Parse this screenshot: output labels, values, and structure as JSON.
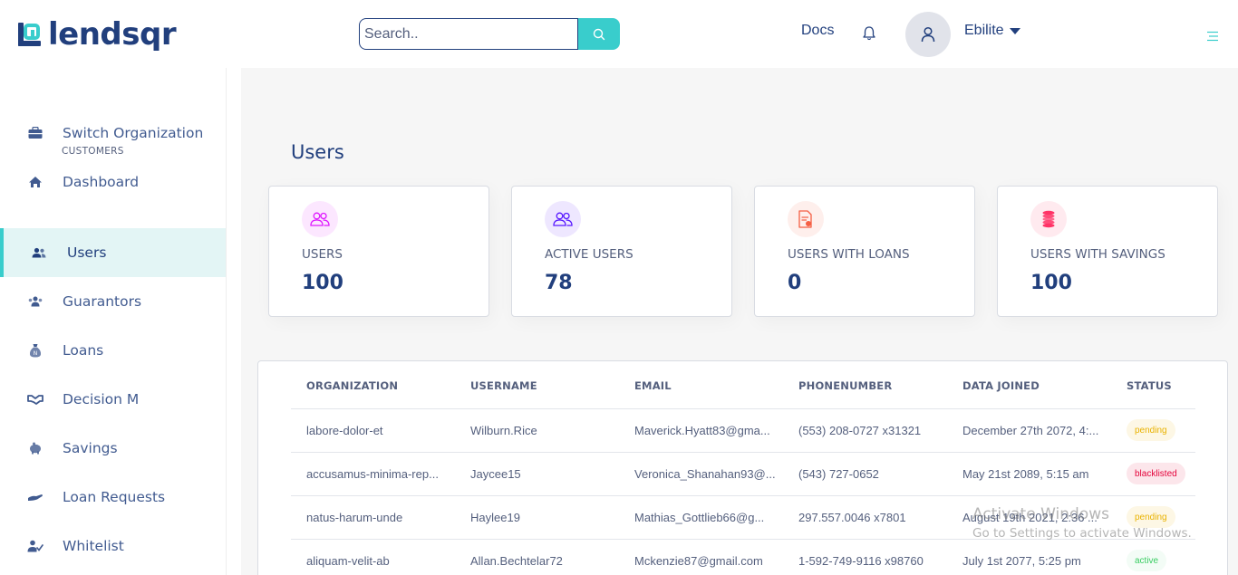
{
  "header": {
    "brand": "lendsqr",
    "search_placeholder": "Search..",
    "docs_label": "Docs",
    "user_name": "Ebilite",
    "accent_color": "#39CDCC",
    "brand_color": "#213F7D"
  },
  "sidebar": {
    "switch_org": "Switch Organization",
    "dashboard": "Dashboard",
    "section_customers": "CUSTOMERS",
    "items": [
      {
        "label": "Users",
        "icon": "users-icon",
        "active": true
      },
      {
        "label": "Guarantors",
        "icon": "guarantors-icon",
        "active": false
      },
      {
        "label": "Loans",
        "icon": "loan-bag-icon",
        "active": false
      },
      {
        "label": "Decision M",
        "icon": "handshake-icon",
        "active": false
      },
      {
        "label": "Savings",
        "icon": "piggy-bank-icon",
        "active": false
      },
      {
        "label": "Loan Requests",
        "icon": "hand-coin-icon",
        "active": false
      },
      {
        "label": "Whitelist",
        "icon": "user-check-icon",
        "active": false
      }
    ]
  },
  "main": {
    "title": "Users",
    "cards": [
      {
        "label": "USERS",
        "value": "100",
        "icon": "users-icon",
        "color": "#DF18FF"
      },
      {
        "label": "ACTIVE USERS",
        "value": "78",
        "icon": "active-users-icon",
        "color": "#5718FF"
      },
      {
        "label": "USERS WITH LOANS",
        "value": "0",
        "icon": "loan-document-icon",
        "color": "#F55F44"
      },
      {
        "label": "USERS WITH SAVINGS",
        "value": "100",
        "icon": "coins-icon",
        "color": "#FF3366"
      }
    ],
    "table": {
      "columns": [
        "ORGANIZATION",
        "USERNAME",
        "EMAIL",
        "PHONENUMBER",
        "DATA JOINED",
        "STATUS"
      ],
      "rows": [
        {
          "org": "labore-dolor-et",
          "username": "Wilburn.Rice",
          "email": "Maverick.Hyatt83@gma...",
          "phone": "(553) 208-0727 x31321",
          "joined": "December 27th 2072, 4:...",
          "status": "pending"
        },
        {
          "org": "accusamus-minima-rep...",
          "username": "Jaycee15",
          "email": "Veronica_Shanahan93@...",
          "phone": "(543) 727-0652",
          "joined": "May 21st 2089, 5:15 am",
          "status": "blacklisted"
        },
        {
          "org": "natus-harum-unde",
          "username": "Haylee19",
          "email": "Mathias_Gottlieb66@g...",
          "phone": "297.557.0046 x7801",
          "joined": "August 19th 2021, 2:36 ...",
          "status": "pending"
        },
        {
          "org": "aliquam-velit-ab",
          "username": "Allan.Bechtelar72",
          "email": "Mckenzie87@gmail.com",
          "phone": "1-592-749-9116 x98760",
          "joined": "July 1st 2077, 5:25 pm",
          "status": "active"
        }
      ]
    }
  },
  "watermark": {
    "line1": "Activate Windows",
    "line2": "Go to Settings to activate Windows."
  }
}
